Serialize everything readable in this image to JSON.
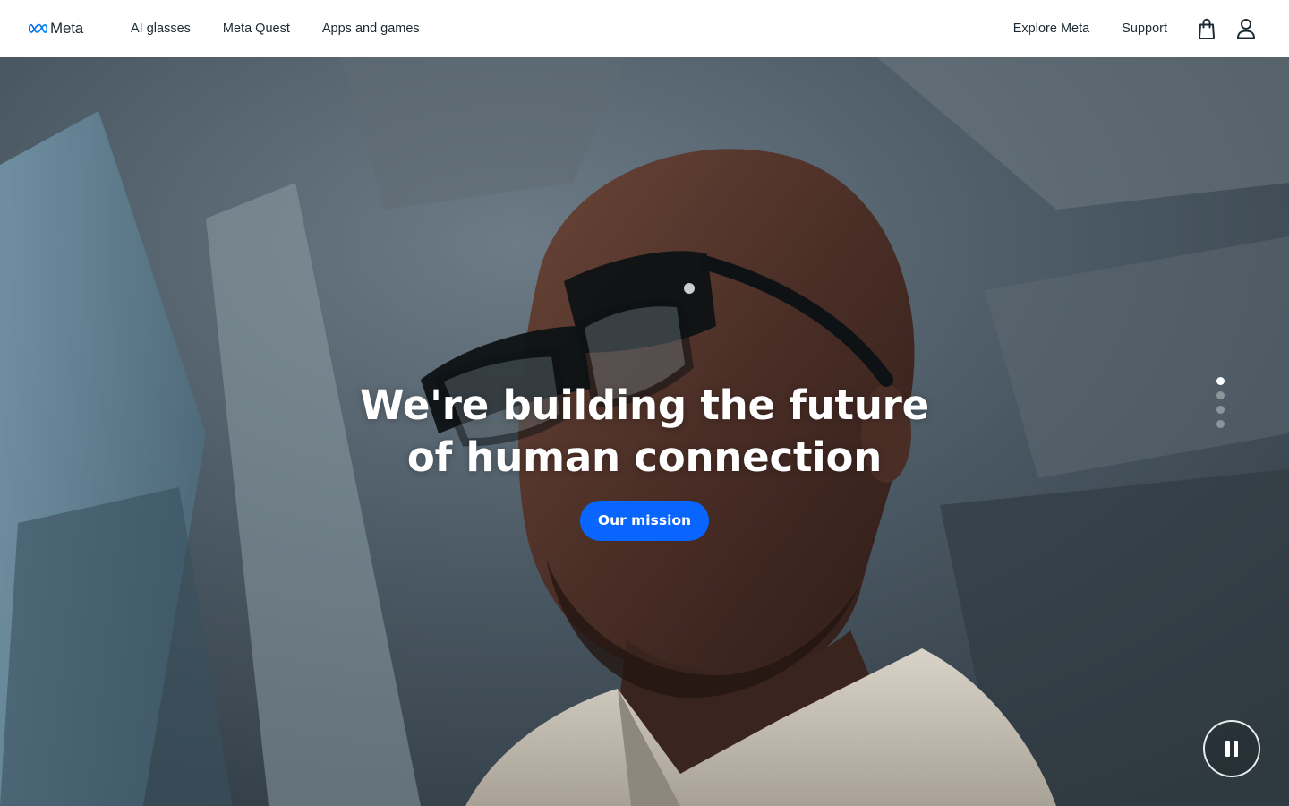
{
  "header": {
    "logo_text": "Meta",
    "nav_left": [
      {
        "label": "AI glasses"
      },
      {
        "label": "Meta Quest"
      },
      {
        "label": "Apps and games"
      }
    ],
    "nav_right": [
      {
        "label": "Explore Meta"
      },
      {
        "label": "Support"
      }
    ],
    "icons": [
      "shopping-bag-icon",
      "account-icon"
    ]
  },
  "hero": {
    "title": "We're building the future of human connection",
    "cta_label": "Our mission",
    "carousel": {
      "slide_count": 4,
      "active_index": 0
    },
    "media_state": "playing",
    "control_icon": "pause-icon"
  },
  "colors": {
    "brand_blue": "#0866ff",
    "text_dark": "#1c2b33",
    "header_bg": "#ffffff"
  }
}
